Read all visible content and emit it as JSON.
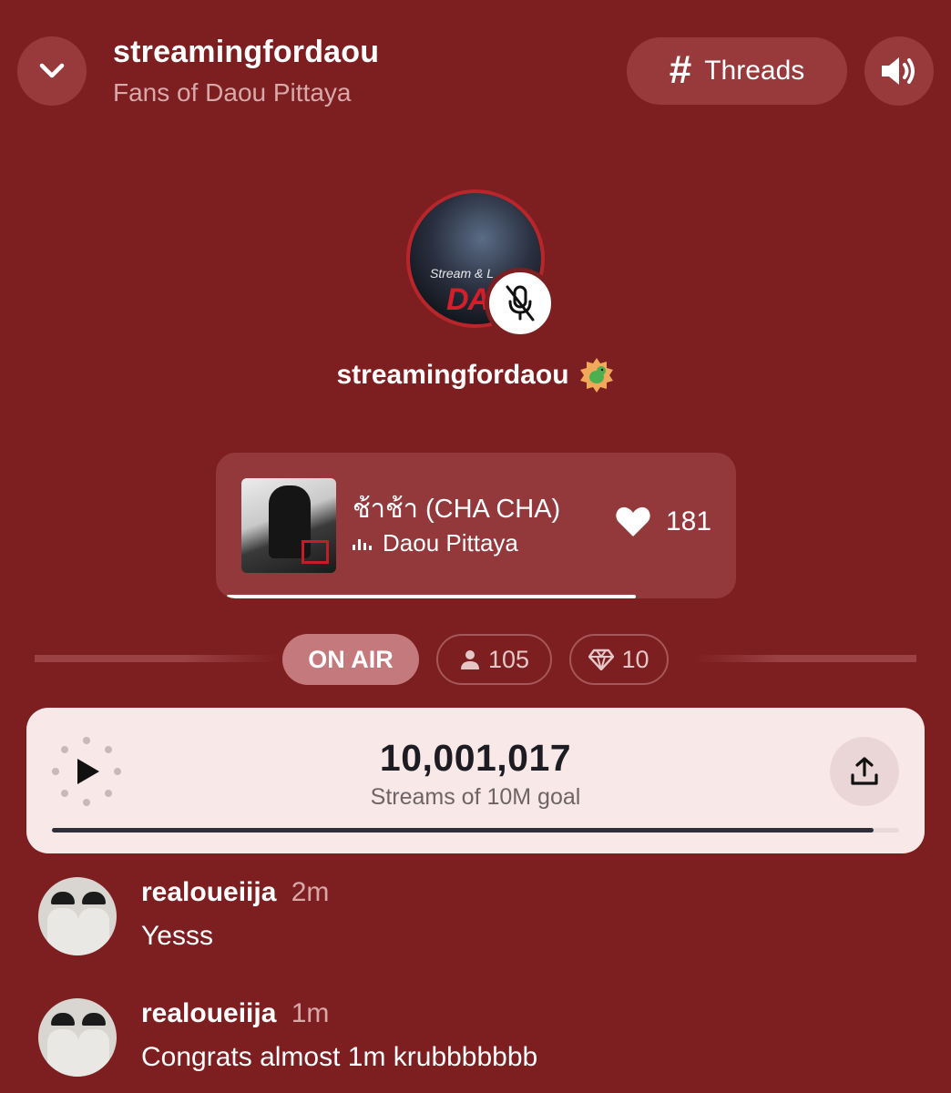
{
  "header": {
    "title": "streamingfordaou",
    "subtitle": "Fans of Daou Pittaya",
    "threads_label": "Threads"
  },
  "host": {
    "name": "streamingfordaou",
    "poster_text": "DAO",
    "poster_script": "Stream & L",
    "badge_icon": "dinosaur-badge-icon",
    "muted": true
  },
  "now_playing": {
    "title": "ช้าช้า (CHA CHA)",
    "artist": "Daou Pittaya",
    "likes": "181",
    "progress": 0.82
  },
  "stats": {
    "status": "ON AIR",
    "listeners": "105",
    "gems": "10"
  },
  "streams": {
    "count": "10,001,017",
    "label": "Streams of 10M goal",
    "progress": 0.97
  },
  "comments": [
    {
      "username": "realoueiija",
      "time": "2m",
      "text": "Yesss"
    },
    {
      "username": "realoueiija",
      "time": "1m",
      "text": "Congrats almost 1m krubbbbbbb"
    }
  ],
  "colors": {
    "background": "#7d1e20",
    "accent_button": "#983a3b",
    "card_bg": "#f8e8e8",
    "goal_fill": "#2e2f3a"
  }
}
